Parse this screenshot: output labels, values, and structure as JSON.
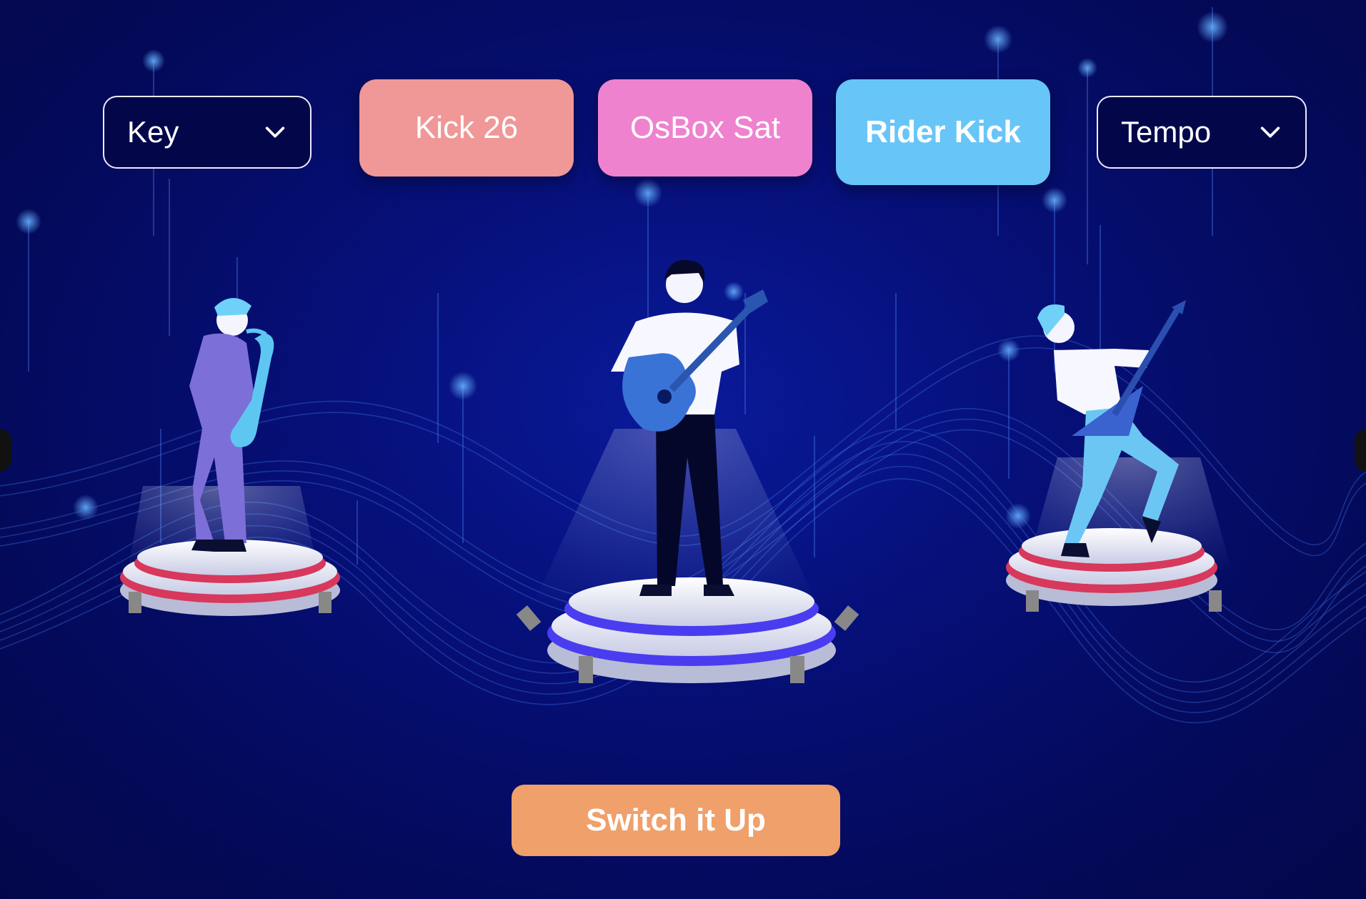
{
  "controls": {
    "key_label": "Key",
    "tempo_label": "Tempo",
    "sounds": [
      {
        "label": "Kick 26",
        "color": "#ef9897",
        "bold": false
      },
      {
        "label": "OsBox Sat",
        "color": "#ee82cf",
        "bold": false
      },
      {
        "label": "Rider Kick",
        "color": "#67c5f8",
        "bold": true
      }
    ]
  },
  "action": {
    "switch_label": "Switch it Up",
    "color": "#f0a06a"
  },
  "colors": {
    "background": "#040a5c",
    "select_border": "#e9ecff",
    "stage_red": "#d7385c",
    "stage_blue": "#4a3df0"
  },
  "performers": [
    {
      "instrument": "saxophone-icon",
      "stage": "red"
    },
    {
      "instrument": "acoustic-guitar-icon",
      "stage": "blue"
    },
    {
      "instrument": "electric-guitar-icon",
      "stage": "red"
    }
  ]
}
